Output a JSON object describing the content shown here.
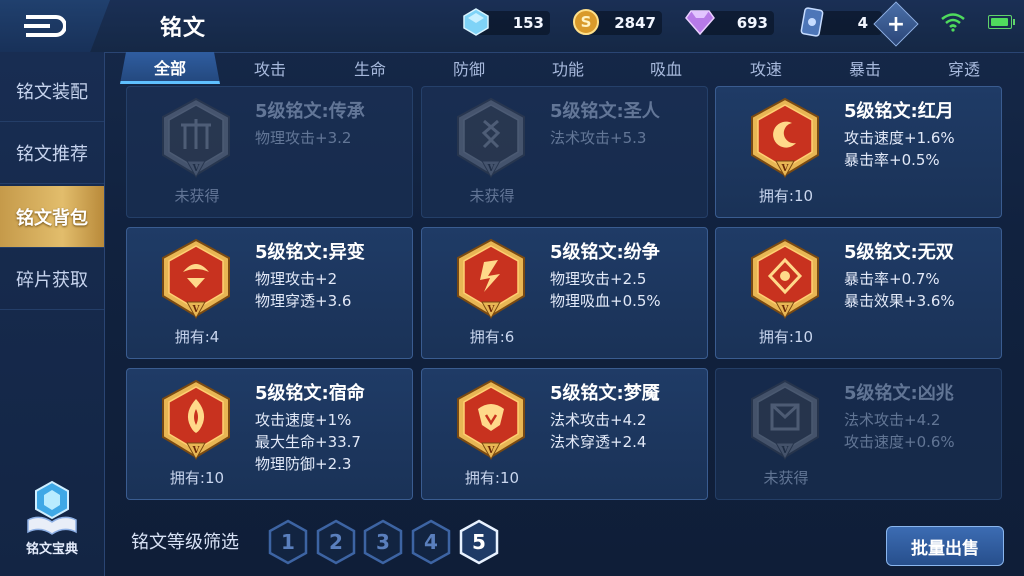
{
  "header": {
    "title": "铭文",
    "resources": [
      {
        "name": "crystal",
        "value": "153",
        "icon": "blue-crystal-icon"
      },
      {
        "name": "gold",
        "value": "2847",
        "icon": "gold-coin-icon"
      },
      {
        "name": "diamond",
        "value": "693",
        "icon": "purple-diamond-icon"
      },
      {
        "name": "card",
        "value": "4",
        "icon": "card-icon"
      }
    ]
  },
  "sidebar": {
    "items": [
      {
        "label": "铭文装配"
      },
      {
        "label": "铭文推荐"
      },
      {
        "label": "铭文背包"
      },
      {
        "label": "碎片获取"
      }
    ],
    "active_index": 2,
    "codex_label": "铭文宝典"
  },
  "tabs": [
    "全部",
    "攻击",
    "生命",
    "防御",
    "功能",
    "吸血",
    "攻速",
    "暴击",
    "穿透"
  ],
  "active_tab": 0,
  "runes": [
    {
      "name": "5级铭文:传承",
      "attrs": [
        "物理攻击+3.2"
      ],
      "count": "未获得",
      "locked": true
    },
    {
      "name": "5级铭文:圣人",
      "attrs": [
        "法术攻击+5.3"
      ],
      "count": "未获得",
      "locked": true
    },
    {
      "name": "5级铭文:红月",
      "attrs": [
        "攻击速度+1.6%",
        "暴击率+0.5%"
      ],
      "count": "拥有:10",
      "locked": false
    },
    {
      "name": "5级铭文:异变",
      "attrs": [
        "物理攻击+2",
        "物理穿透+3.6"
      ],
      "count": "拥有:4",
      "locked": false
    },
    {
      "name": "5级铭文:纷争",
      "attrs": [
        "物理攻击+2.5",
        "物理吸血+0.5%"
      ],
      "count": "拥有:6",
      "locked": false
    },
    {
      "name": "5级铭文:无双",
      "attrs": [
        "暴击率+0.7%",
        "暴击效果+3.6%"
      ],
      "count": "拥有:10",
      "locked": false
    },
    {
      "name": "5级铭文:宿命",
      "attrs": [
        "攻击速度+1%",
        "最大生命+33.7",
        "物理防御+2.3"
      ],
      "count": "拥有:10",
      "locked": false
    },
    {
      "name": "5级铭文:梦魇",
      "attrs": [
        "法术攻击+4.2",
        "法术穿透+2.4"
      ],
      "count": "拥有:10",
      "locked": false
    },
    {
      "name": "5级铭文:凶兆",
      "attrs": [
        "法术攻击+4.2",
        "攻击速度+0.6%"
      ],
      "count": "未获得",
      "locked": true
    }
  ],
  "emblem_level_mark": "V",
  "filter": {
    "label": "铭文等级筛选",
    "levels": [
      "1",
      "2",
      "3",
      "4",
      "5"
    ],
    "active_index": 4
  },
  "actions": {
    "batch_sell": "批量出售"
  },
  "colors": {
    "accent": "#e2bd6c",
    "tab_underline": "#5fc0ff",
    "emblem_red": "#c8321f",
    "emblem_gold": "#e8b654"
  }
}
